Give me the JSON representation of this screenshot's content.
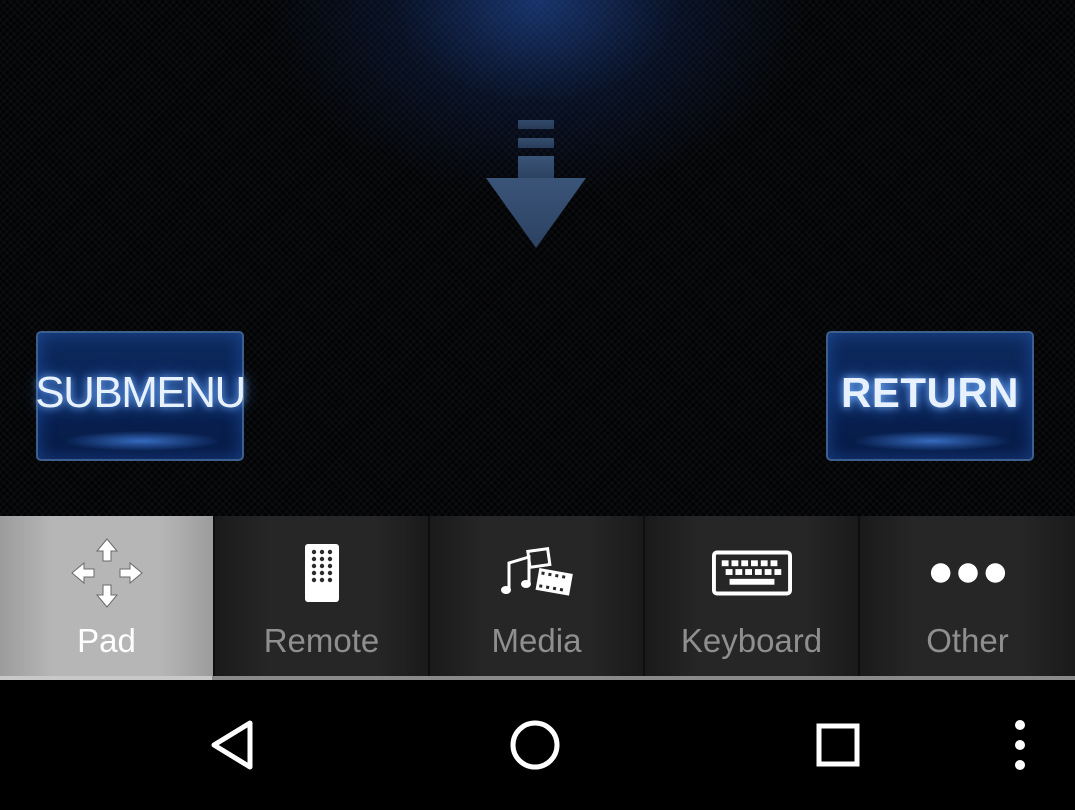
{
  "pad": {
    "submenu_label": "SUBMENU",
    "return_label": "RETURN",
    "swipe_hint_icon": "swipe-down-arrow-icon",
    "accent_color": "#1e4fa8"
  },
  "tabs": [
    {
      "label": "Pad",
      "icon": "directional-pad-icon",
      "active": true
    },
    {
      "label": "Remote",
      "icon": "remote-control-icon",
      "active": false
    },
    {
      "label": "Media",
      "icon": "media-icon",
      "active": false
    },
    {
      "label": "Keyboard",
      "icon": "keyboard-icon",
      "active": false
    },
    {
      "label": "Other",
      "icon": "more-dots-icon",
      "active": false
    }
  ],
  "nav_bar": {
    "back_icon": "back-triangle-icon",
    "home_icon": "home-circle-icon",
    "recents_icon": "recents-square-icon",
    "menu_icon": "overflow-menu-icon"
  }
}
